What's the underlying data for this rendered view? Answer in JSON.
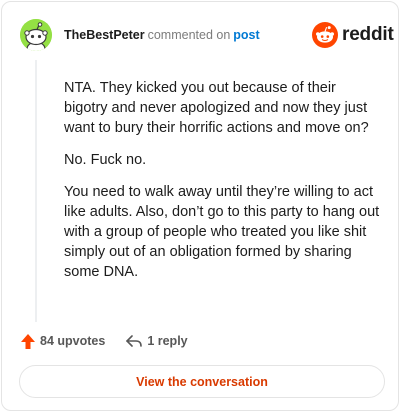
{
  "header": {
    "username": "TheBestPeter",
    "action": "commented on",
    "post_link": "post"
  },
  "brand": {
    "name": "reddit",
    "icon": "reddit-snoo-icon",
    "color": "#ff4500"
  },
  "comment": {
    "paragraphs": [
      "NTA. They kicked you out because of their bigotry and never apologized and now they just want to bury their horrific actions and move on?",
      "No. Fuck no.",
      "You need to walk away until they’re willing to act like adults. Also, don’t go to this party to hang out with a group of people who treated you like shit simply out of an obligation formed by sharing some DNA."
    ]
  },
  "actions": {
    "upvotes_label": "84 upvotes",
    "upvote_icon": "upvote-arrow-icon",
    "upvote_color": "#ff4500",
    "replies_label": "1 reply",
    "reply_icon": "reply-arrow-icon"
  },
  "cta": {
    "label": "View the conversation",
    "color": "#d93a00"
  },
  "avatar": {
    "icon": "snoo-avatar-icon",
    "background": "#94e044"
  }
}
